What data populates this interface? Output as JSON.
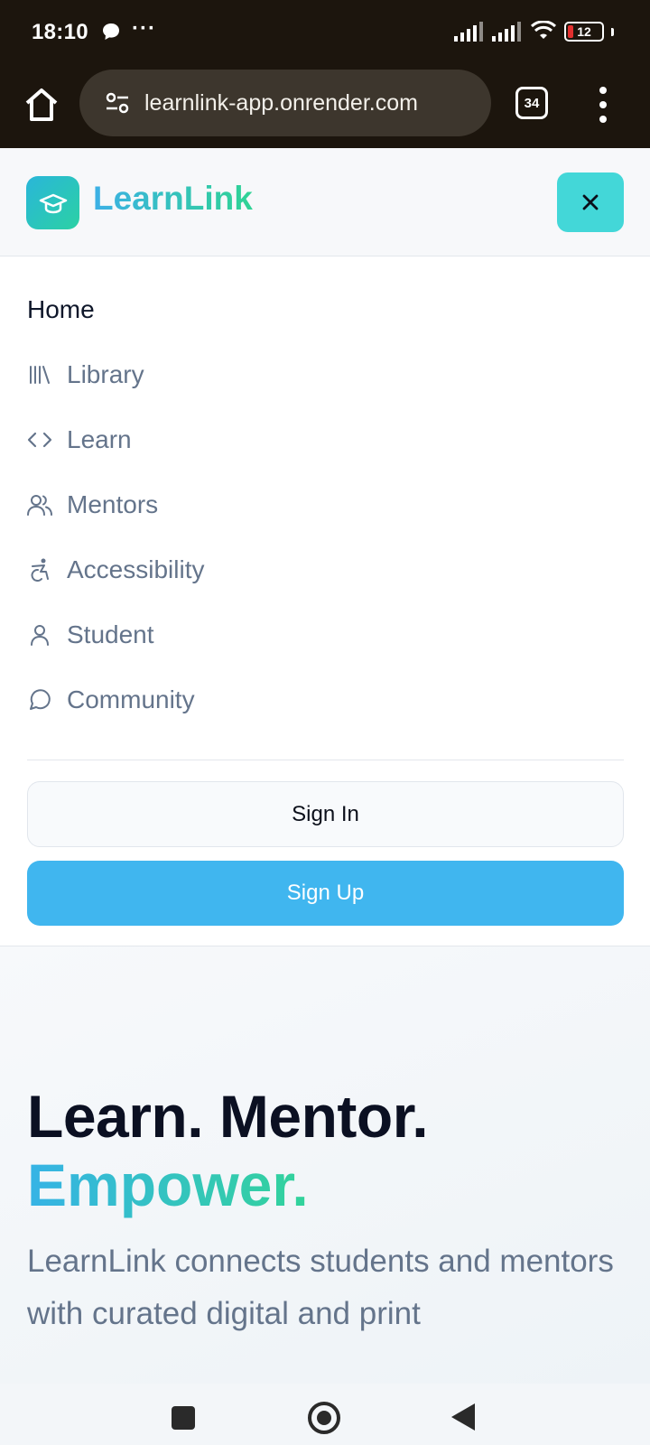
{
  "status_bar": {
    "time": "18:10",
    "more": "···",
    "battery": "12",
    "icons": [
      "message-icon",
      "signal-icon",
      "signal-icon",
      "wifi-icon",
      "battery-icon"
    ],
    "colors": {
      "background": "#1c150d",
      "battery_low": "#e3302f"
    }
  },
  "browser": {
    "url": "learnlink-app.onrender.com",
    "tab_count": "34",
    "icons": [
      "home-icon",
      "site-settings-icon",
      "tabs-icon",
      "more-vert-icon"
    ]
  },
  "header": {
    "brand": "LearnLink",
    "logo_icon": "graduation-cap-icon",
    "close_icon": "close-icon",
    "colors": {
      "brand_start": "#3cb0e6",
      "brand_end": "#2fd394",
      "close_bg": "#43d7d8"
    }
  },
  "nav": {
    "items": [
      {
        "label": "Home",
        "icon": null,
        "active": true
      },
      {
        "label": "Library",
        "icon": "library-icon",
        "active": false
      },
      {
        "label": "Learn",
        "icon": "code-icon",
        "active": false
      },
      {
        "label": "Mentors",
        "icon": "users-icon",
        "active": false
      },
      {
        "label": "Accessibility",
        "icon": "accessibility-icon",
        "active": false
      },
      {
        "label": "Student",
        "icon": "user-icon",
        "active": false
      },
      {
        "label": "Community",
        "icon": "message-circle-icon",
        "active": false
      }
    ],
    "sign_in": "Sign In",
    "sign_up": "Sign Up",
    "colors": {
      "sign_up_bg": "#40b6ef"
    }
  },
  "hero": {
    "title_part1": "Learn. Mentor.",
    "title_part2": "Empower.",
    "description": "LearnLink connects students and mentors with curated digital and print"
  },
  "android_nav": {
    "icons": [
      "recents-icon",
      "home-circle-icon",
      "back-icon"
    ]
  }
}
